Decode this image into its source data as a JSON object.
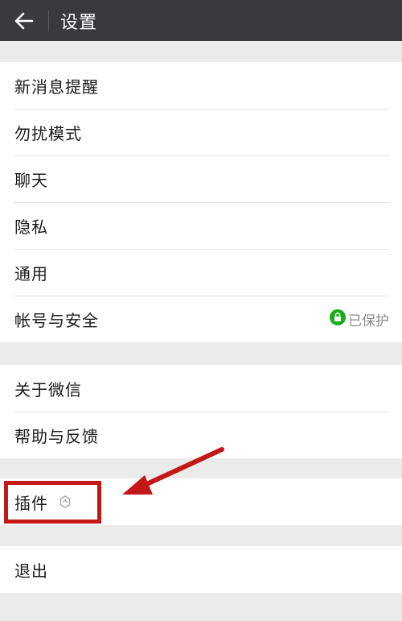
{
  "header": {
    "title": "设置",
    "back_icon": "arrow-left-icon"
  },
  "groups": [
    {
      "items": [
        {
          "label": "新消息提醒"
        },
        {
          "label": "勿扰模式"
        },
        {
          "label": "聊天"
        },
        {
          "label": "隐私"
        },
        {
          "label": "通用"
        },
        {
          "label": "帐号与安全",
          "status": "已保护",
          "status_icon": "lock-icon",
          "status_color": "#1aad19"
        }
      ]
    },
    {
      "items": [
        {
          "label": "关于微信"
        },
        {
          "label": "帮助与反馈"
        }
      ]
    },
    {
      "items": [
        {
          "label": "插件",
          "icon": "plugin-icon"
        }
      ]
    },
    {
      "items": [
        {
          "label": "退出"
        }
      ]
    }
  ],
  "annotation": {
    "color": "#c21818"
  }
}
